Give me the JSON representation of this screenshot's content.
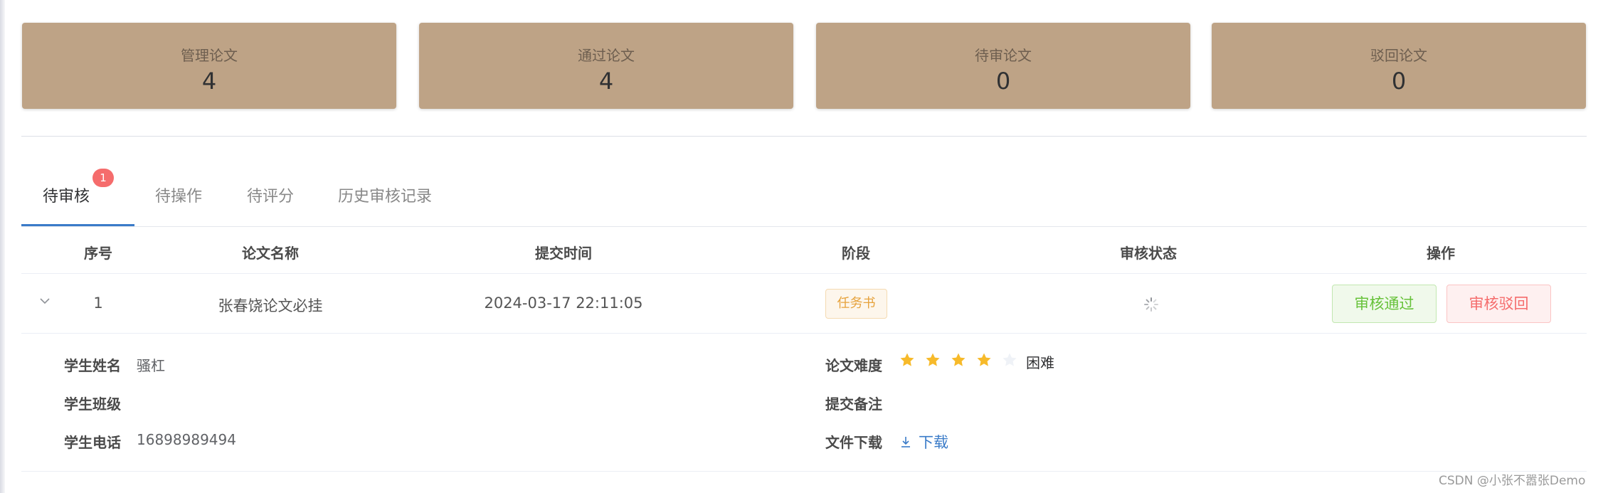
{
  "stats": [
    {
      "label": "管理论文",
      "value": "4"
    },
    {
      "label": "通过论文",
      "value": "4"
    },
    {
      "label": "待审论文",
      "value": "0"
    },
    {
      "label": "驳回论文",
      "value": "0"
    }
  ],
  "tabs": [
    {
      "label": "待审核",
      "badge": "1",
      "active": true
    },
    {
      "label": "待操作"
    },
    {
      "label": "待评分"
    },
    {
      "label": "历史审核记录"
    }
  ],
  "table": {
    "headers": [
      "序号",
      "论文名称",
      "提交时间",
      "阶段",
      "审核状态",
      "操作"
    ],
    "rows": [
      {
        "index": "1",
        "name": "张春饶论文必挂",
        "submit_time": "2024-03-17 22:11:05",
        "stage": "任务书",
        "status_icon": "loading-icon",
        "actions": {
          "approve": "审核通过",
          "reject": "审核驳回"
        }
      }
    ]
  },
  "detail": {
    "student_name_label": "学生姓名",
    "student_name": "骚杠",
    "student_class_label": "学生班级",
    "student_class": "",
    "student_phone_label": "学生电话",
    "student_phone": "16898989494",
    "difficulty_label": "论文难度",
    "difficulty_rating": 4,
    "difficulty_max": 5,
    "difficulty_text": "困难",
    "remark_label": "提交备注",
    "remark": "",
    "file_label": "文件下载",
    "download_text": "下载"
  },
  "colors": {
    "card_bg": "#bea386",
    "star_on": "#f7ba2a",
    "star_off": "#eff2f7",
    "tab_accent": "#3a7bc8",
    "badge": "#f56c6c"
  },
  "watermark": "CSDN @小张不嚣张Demo"
}
